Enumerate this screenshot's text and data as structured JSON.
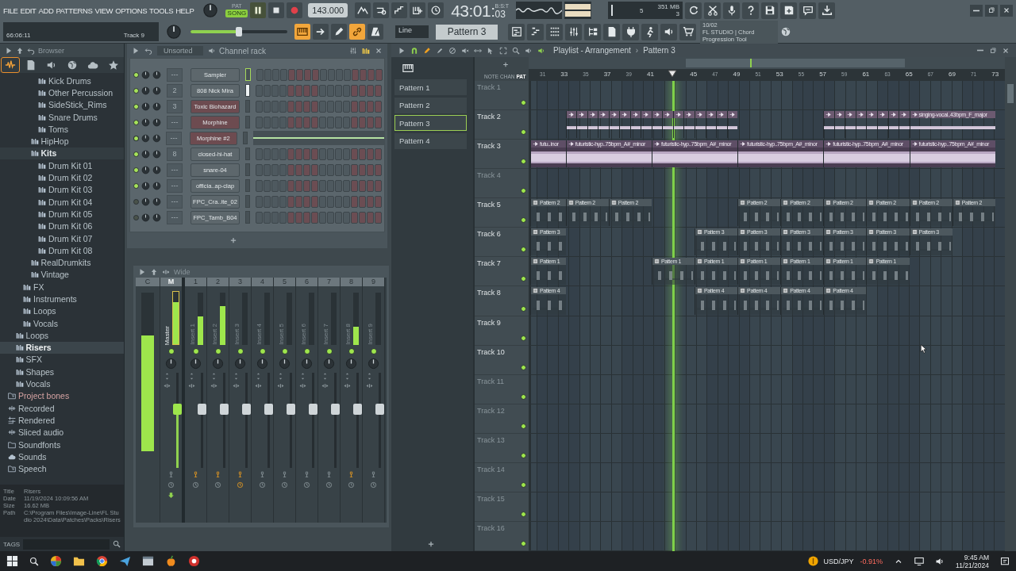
{
  "menu": [
    "FILE",
    "EDIT",
    "ADD",
    "PATTERNS",
    "VIEW",
    "OPTIONS",
    "TOOLS",
    "HELP"
  ],
  "hint": {
    "time": "66:06:11",
    "text": "Track 9"
  },
  "transport": {
    "modes": [
      {
        "label": "PAT",
        "selected": false
      },
      {
        "label": "SONG",
        "selected": true
      }
    ],
    "playing": true,
    "tempo": "143.000",
    "time": "43:01:",
    "ticks": "03",
    "time_format": "B:S:T"
  },
  "master_volume": {
    "level": 0.5
  },
  "cpu": {
    "cpu": "5",
    "memory": "351 MB",
    "polyphony": "3"
  },
  "toggles": [
    {
      "active": true
    },
    {
      "active": false
    },
    {
      "active": false
    },
    {
      "active": true
    },
    {
      "active": false
    }
  ],
  "snap": "Line",
  "pattern_selector": "Pattern 3",
  "news": {
    "date": "10/02",
    "text": "FL STUDIO | Chord Progression Tool"
  },
  "browser": {
    "title": "Browser",
    "tabs": [
      {
        "selected": true
      },
      {
        "selected": false
      },
      {
        "selected": false
      },
      {
        "selected": false
      },
      {
        "selected": false
      },
      {
        "selected": false
      }
    ],
    "tree": [
      {
        "children": [
          {
            "children": [
              {
                "children": [
                  {
                    "children": [
                      {
                        "label": "Kick Drums"
                      },
                      {
                        "label": "Other Percussion"
                      },
                      {
                        "label": "SideStick_Rims"
                      },
                      {
                        "label": "Snare Drums"
                      },
                      {
                        "label": "Toms"
                      }
                    ]
                  },
                  {
                    "label": "HipHop"
                  },
                  {
                    "label": "Kits",
                    "expanded": true,
                    "children": [
                      {
                        "label": "Drum Kit 01"
                      },
                      {
                        "label": "Drum Kit 02"
                      },
                      {
                        "label": "Drum Kit 03"
                      },
                      {
                        "label": "Drum Kit 04"
                      },
                      {
                        "label": "Drum Kit 05"
                      },
                      {
                        "label": "Drum Kit 06"
                      },
                      {
                        "label": "Drum Kit 07"
                      },
                      {
                        "label": "Drum Kit 08"
                      }
                    ]
                  },
                  {
                    "label": "RealDrumkits"
                  },
                  {
                    "label": "Vintage"
                  }
                ]
              },
              {
                "label": "FX"
              },
              {
                "label": "Instruments"
              },
              {
                "label": "Loops"
              },
              {
                "label": "Vocals"
              }
            ]
          },
          {
            "label": "Loops",
            "selected": false
          },
          {
            "label": "Risers",
            "selected": true
          },
          {
            "label": "SFX",
            "selected": false
          },
          {
            "label": "Shapes",
            "selected": false
          },
          {
            "label": "Vocals",
            "selected": false
          }
        ]
      },
      {
        "label": "Project bones",
        "kind": "project"
      },
      {
        "label": "Recorded",
        "kind": "recorded"
      },
      {
        "label": "Rendered",
        "kind": "rendered"
      },
      {
        "label": "Sliced audio",
        "kind": "recorded"
      },
      {
        "label": "Soundfonts",
        "kind": "folder"
      },
      {
        "label": "Sounds",
        "kind": "cloud"
      },
      {
        "label": "Speech",
        "kind": "project"
      }
    ],
    "info": [
      {
        "label": "Title",
        "value": "Risers"
      },
      {
        "label": "Date",
        "value": "11/19/2024 10:09:56 AM"
      },
      {
        "label": "Size",
        "value": "16.62 MB"
      },
      {
        "label": "Path",
        "value": "C:\\Program Files\\Image-Line\\FL Studio 2024\\Data\\Patches\\Packs\\Risers"
      }
    ],
    "tags_label": "TAGS"
  },
  "channel_rack": {
    "filter": "Unsorted",
    "title": "Channel rack",
    "channels": [
      {
        "name": "Sampler",
        "number": "---",
        "enabled": true,
        "color": "#5d676c",
        "kind": "steps",
        "selected": true,
        "highlighted": false
      },
      {
        "name": "808 Nick Mira",
        "number": "2",
        "enabled": true,
        "color": "#5d676c",
        "kind": "steps",
        "selected": false,
        "highlighted": true
      },
      {
        "name": "Toxic Biohazard",
        "number": "3",
        "enabled": true,
        "color": "#6d4b50",
        "kind": "steps",
        "selected": false,
        "highlighted": false
      },
      {
        "name": "Morphine",
        "number": "---",
        "enabled": true,
        "color": "#6d4b50",
        "kind": "steps",
        "selected": false,
        "highlighted": false
      },
      {
        "name": "Morphine #2",
        "number": "---",
        "enabled": true,
        "color": "#6d4b50",
        "kind": "pianoroll",
        "selected": false,
        "highlighted": false
      },
      {
        "name": "closed-hi-hat",
        "number": "8",
        "enabled": true,
        "color": "#5d676c",
        "kind": "steps",
        "selected": false,
        "highlighted": false
      },
      {
        "name": "snare-04",
        "number": "---",
        "enabled": true,
        "color": "#5d676c",
        "kind": "steps",
        "selected": false,
        "highlighted": false
      },
      {
        "name": "officia..ap-clap",
        "number": "---",
        "enabled": true,
        "color": "#5d676c",
        "kind": "steps",
        "selected": false,
        "highlighted": false
      },
      {
        "name": "FPC_Cra..ite_02",
        "number": "---",
        "enabled": false,
        "color": "#5d676c",
        "kind": "steps",
        "selected": false,
        "highlighted": false
      },
      {
        "name": "FPC_Tamb_B04",
        "number": "---",
        "enabled": false,
        "color": "#5d676c",
        "kind": "steps",
        "selected": false,
        "highlighted": false
      }
    ]
  },
  "mixer": {
    "preset": "Wide",
    "strips": [
      {
        "kind": "current",
        "label": "C",
        "level": 0.73
      },
      {
        "kind": "master",
        "label": "M",
        "name": "Master",
        "level": 0.8,
        "fader": {
          "level": 0.62
        }
      },
      {
        "kind": "insert",
        "label": "1",
        "name": "Insert 1",
        "level": 0.55,
        "fader": {
          "level": 0.62
        },
        "routed": true,
        "delay": false
      },
      {
        "kind": "insert",
        "label": "2",
        "name": "Insert 2",
        "level": 0.75,
        "fader": {
          "level": 0.62
        },
        "routed": true,
        "delay": false
      },
      {
        "kind": "insert",
        "label": "3",
        "name": "Insert 3",
        "level": 0,
        "fader": {
          "level": 0.62
        },
        "routed": true,
        "delay": true
      },
      {
        "kind": "insert",
        "label": "4",
        "name": "Insert 4",
        "level": 0,
        "fader": {
          "level": 0.62
        },
        "routed": false,
        "delay": false
      },
      {
        "kind": "insert",
        "label": "5",
        "name": "Insert 5",
        "level": 0,
        "fader": {
          "level": 0.62
        },
        "routed": false,
        "delay": false
      },
      {
        "kind": "insert",
        "label": "6",
        "name": "Insert 6",
        "level": 0,
        "fader": {
          "level": 0.62
        },
        "routed": false,
        "delay": false
      },
      {
        "kind": "insert",
        "label": "7",
        "name": "Insert 7",
        "level": 0,
        "fader": {
          "level": 0.62
        },
        "routed": false,
        "delay": false
      },
      {
        "kind": "insert",
        "label": "8",
        "name": "Insert 8",
        "level": 0.35,
        "fader": {
          "level": 0.62
        },
        "routed": true,
        "delay": false
      },
      {
        "kind": "insert",
        "label": "9",
        "name": "Insert 9",
        "level": 0,
        "fader": {
          "level": 0.62
        },
        "routed": false,
        "delay": false
      }
    ]
  },
  "playlist": {
    "title": "Playlist - Arrangement",
    "separator": "›",
    "pattern": "Pattern 3",
    "patterns": [
      {
        "name": "Pattern 1",
        "selected": false
      },
      {
        "name": "Pattern 2",
        "selected": false
      },
      {
        "name": "Pattern 3",
        "selected": true
      },
      {
        "name": "Pattern 4",
        "selected": false
      }
    ],
    "modes": [
      {
        "label": "NOTE",
        "selected": false
      },
      {
        "label": "CHAN",
        "selected": false
      },
      {
        "label": "PAT",
        "selected": true
      }
    ],
    "ruler": [
      {
        "label": "31"
      },
      {
        "label": "33"
      },
      {
        "label": "35"
      },
      {
        "label": "37"
      },
      {
        "label": "39"
      },
      {
        "label": "41"
      },
      {
        "playhead": true
      },
      {
        "label": "45"
      },
      {
        "label": "47"
      },
      {
        "label": "49"
      },
      {
        "label": "51"
      },
      {
        "label": "53"
      },
      {
        "label": "55"
      },
      {
        "label": "57"
      },
      {
        "label": "59"
      },
      {
        "label": "61"
      },
      {
        "label": "63"
      },
      {
        "label": "65"
      },
      {
        "label": "67"
      },
      {
        "label": "69"
      },
      {
        "label": "71"
      },
      {
        "label": "73"
      }
    ],
    "tracks": [
      {
        "name": "Track 1",
        "empty": true
      },
      {
        "name": "Track 2",
        "empty": false,
        "clips": [
          {
            "kind": "gap"
          },
          {
            "kind": "slice"
          },
          {
            "kind": "slice"
          },
          {
            "kind": "slice"
          },
          {
            "kind": "slice"
          },
          {
            "kind": "slice"
          },
          {
            "kind": "slice"
          },
          {
            "kind": "slice"
          },
          {
            "kind": "slice"
          },
          {
            "kind": "slice"
          },
          {
            "kind": "slice"
          },
          {
            "kind": "slice"
          },
          {
            "kind": "slice"
          },
          {
            "kind": "slice"
          },
          {
            "kind": "slice"
          },
          {
            "kind": "slice"
          },
          {
            "kind": "slice"
          },
          {
            "kind": "gap"
          },
          {
            "kind": "gap"
          },
          {
            "kind": "slice"
          },
          {
            "kind": "slice"
          },
          {
            "kind": "slice"
          },
          {
            "kind": "slice"
          },
          {
            "kind": "slice"
          },
          {
            "kind": "slice"
          },
          {
            "kind": "slice"
          },
          {
            "kind": "slice"
          },
          {
            "kind": "vocal",
            "label": "singing-vocal..43bpm_F_major"
          }
        ]
      },
      {
        "name": "Track 3",
        "empty": false,
        "clips": [
          {
            "kind": "sample",
            "label": "futu..inor"
          },
          {
            "kind": "audio",
            "label": "futuristic-hyp..75bpm_A#_minor"
          },
          {
            "kind": "audio",
            "label": "futuristic-hyp..75bpm_A#_minor"
          },
          {
            "kind": "audio",
            "label": "futuristic-hyp..75bpm_A#_minor"
          },
          {
            "kind": "audio",
            "label": "futuristic-hyp..75bpm_A#_minor"
          },
          {
            "kind": "audio",
            "label": "futuristic-hyp..75bpm_A#_minor"
          }
        ]
      },
      {
        "name": "Track 4",
        "empty": true
      },
      {
        "name": "Track 5",
        "empty": false,
        "clips": [
          {
            "kind": "pattern",
            "label": "Pattern 2"
          },
          {
            "kind": "pattern",
            "label": "Pattern 2"
          },
          {
            "kind": "pattern",
            "label": "Pattern 2"
          },
          {
            "kind": "gap"
          },
          {
            "kind": "gap"
          },
          {
            "kind": "pattern",
            "label": "Pattern 2"
          },
          {
            "kind": "pattern",
            "label": "Pattern 2"
          },
          {
            "kind": "pattern",
            "label": "Pattern 2"
          },
          {
            "kind": "pattern",
            "label": "Pattern 2"
          },
          {
            "kind": "pattern",
            "label": "Pattern 2"
          },
          {
            "kind": "pattern",
            "label": "Pattern 2"
          }
        ]
      },
      {
        "name": "Track 6",
        "empty": false,
        "clips": [
          {
            "kind": "pattern",
            "label": "Pattern 3"
          },
          {
            "kind": "gap"
          },
          {
            "kind": "gap"
          },
          {
            "kind": "gap"
          },
          {
            "kind": "pattern",
            "label": "Pattern 3"
          },
          {
            "kind": "pattern",
            "label": "Pattern 3"
          },
          {
            "kind": "pattern",
            "label": "Pattern 3"
          },
          {
            "kind": "pattern",
            "label": "Pattern 3"
          },
          {
            "kind": "pattern",
            "label": "Pattern 3"
          },
          {
            "kind": "pattern",
            "label": "Pattern 3"
          }
        ]
      },
      {
        "name": "Track 7",
        "empty": false,
        "clips": [
          {
            "kind": "pattern",
            "label": "Pattern 1"
          },
          {
            "kind": "gap"
          },
          {
            "kind": "gap"
          },
          {
            "kind": "pattern",
            "label": "Pattern 1"
          },
          {
            "kind": "pattern",
            "label": "Pattern 1"
          },
          {
            "kind": "pattern",
            "label": "Pattern 1"
          },
          {
            "kind": "pattern",
            "label": "Pattern 1"
          },
          {
            "kind": "pattern",
            "label": "Pattern 1"
          },
          {
            "kind": "pattern",
            "label": "Pattern 1"
          }
        ]
      },
      {
        "name": "Track 8",
        "empty": false,
        "clips": [
          {
            "kind": "pattern",
            "label": "Pattern 4"
          },
          {
            "kind": "gap"
          },
          {
            "kind": "gap"
          },
          {
            "kind": "gap"
          },
          {
            "kind": "pattern",
            "label": "Pattern 4"
          },
          {
            "kind": "pattern",
            "label": "Pattern 4"
          },
          {
            "kind": "pattern",
            "label": "Pattern 4"
          },
          {
            "kind": "pattern",
            "label": "Pattern 4"
          }
        ]
      },
      {
        "name": "Track 9",
        "empty": false
      },
      {
        "name": "Track 10",
        "empty": false
      },
      {
        "name": "Track 11",
        "empty": true
      },
      {
        "name": "Track 12",
        "empty": true
      },
      {
        "name": "Track 13",
        "empty": true
      },
      {
        "name": "Track 14",
        "empty": true
      },
      {
        "name": "Track 15",
        "empty": true
      },
      {
        "name": "Track 16",
        "empty": true
      }
    ]
  },
  "taskbar": {
    "ticker": "USD/JPY",
    "change": "-0.91%",
    "time": "9:45 AM",
    "date": "11/21/2024"
  }
}
